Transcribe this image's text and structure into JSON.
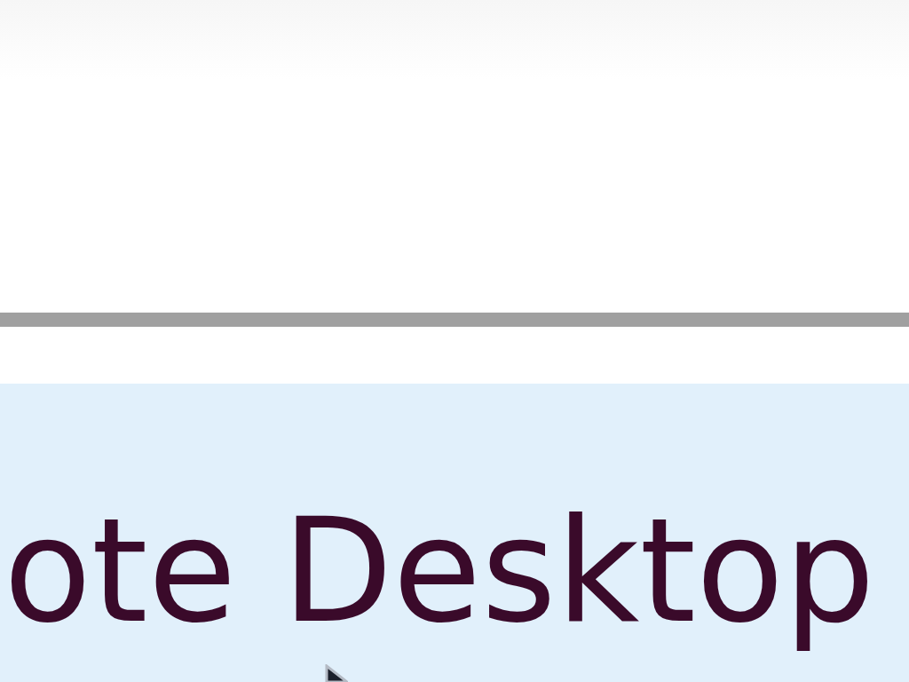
{
  "banner": {
    "text": "ote Desktop"
  }
}
